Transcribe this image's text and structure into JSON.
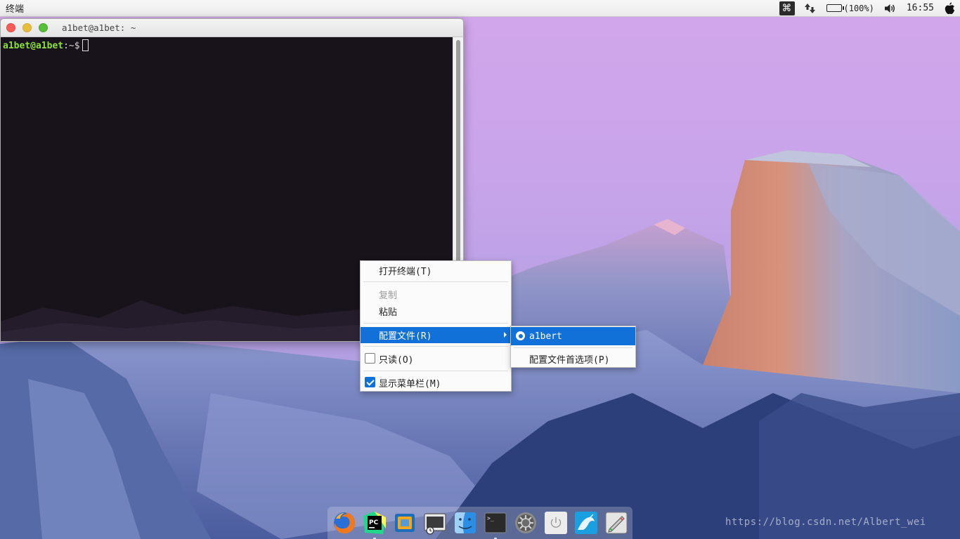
{
  "top_panel": {
    "app_name": "终端",
    "cmd_symbol": "⌘",
    "battery_label": "(100%)",
    "battery_level": 1.0,
    "clock": "16:55"
  },
  "terminal": {
    "title": "a1bet@a1bet: ~",
    "prompt_user": "a1bet@a1bet",
    "prompt_path": ":~$"
  },
  "context_menu": {
    "open_terminal": "打开终端(T)",
    "copy": "复制",
    "paste": "粘贴",
    "profiles": "配置文件(R)",
    "read_only": "只读(O)",
    "read_only_checked": false,
    "show_menubar": "显示菜单栏(M)",
    "show_menubar_checked": true
  },
  "profiles_submenu": {
    "profile_name": "a1bert",
    "profile_prefs": "配置文件首选项(P)"
  },
  "dock": {
    "items": [
      "firefox-icon",
      "pycharm-icon",
      "virtualbox-icon",
      "screenshot-icon",
      "finder-icon",
      "terminal-icon",
      "system-settings-icon",
      "power-icon",
      "mysql-workbench-icon",
      "text-editor-icon"
    ]
  },
  "watermark": "https://blog.csdn.net/Albert_wei",
  "colors": {
    "menu_highlight": "#1171d8",
    "prompt_green": "#8ae234",
    "terminal_bg": "#18121a"
  }
}
